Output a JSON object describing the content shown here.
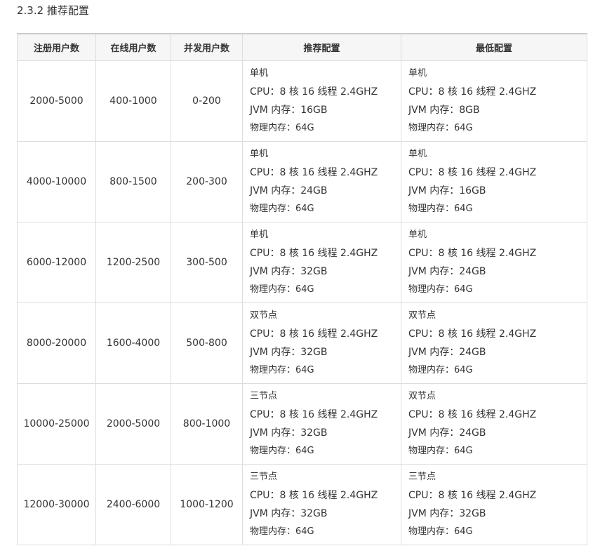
{
  "section_title": "2.3.2 推荐配置",
  "table": {
    "headers": [
      "注册用户数",
      "在线用户数",
      "并发用户数",
      "推荐配置",
      "最低配置"
    ],
    "rows": [
      {
        "registered": "2000-5000",
        "online": "400-1000",
        "concurrent": "0-200",
        "recommended": [
          "单机",
          "CPU：8 核 16 线程 2.4GHZ",
          "JVM 内存：16GB",
          "物理内存：64G"
        ],
        "minimum": [
          "单机",
          "CPU：8 核 16 线程 2.4GHZ",
          "JVM 内存：8GB",
          "物理内存：64G"
        ]
      },
      {
        "registered": "4000-10000",
        "online": "800-1500",
        "concurrent": "200-300",
        "recommended": [
          "单机",
          "CPU：8 核 16 线程 2.4GHZ",
          "JVM 内存：24GB",
          "物理内存：64G"
        ],
        "minimum": [
          "单机",
          "CPU：8 核 16 线程 2.4GHZ",
          "JVM 内存：16GB",
          "物理内存：64G"
        ]
      },
      {
        "registered": "6000-12000",
        "online": "1200-2500",
        "concurrent": "300-500",
        "recommended": [
          "单机",
          "CPU：8 核 16 线程 2.4GHZ",
          "JVM 内存：32GB",
          "物理内存：64G"
        ],
        "minimum": [
          "单机",
          "CPU：8 核 16 线程 2.4GHZ",
          "JVM 内存：24GB",
          "物理内存：64G"
        ]
      },
      {
        "registered": "8000-20000",
        "online": "1600-4000",
        "concurrent": "500-800",
        "recommended": [
          "双节点",
          "CPU：8 核 16 线程 2.4GHZ",
          "JVM 内存：32GB",
          "物理内存：64G"
        ],
        "minimum": [
          "双节点",
          "CPU：8 核 16 线程 2.4GHZ",
          "JVM 内存：24GB",
          "物理内存：64G"
        ]
      },
      {
        "registered": "10000-25000",
        "online": "2000-5000",
        "concurrent": "800-1000",
        "recommended": [
          "三节点",
          "CPU：8 核 16 线程 2.4GHZ",
          "JVM 内存：32GB",
          "物理内存：64G"
        ],
        "minimum": [
          "双节点",
          "CPU：8 核 16 线程 2.4GHZ",
          "JVM 内存：24GB",
          "物理内存：64G"
        ]
      },
      {
        "registered": "12000-30000",
        "online": "2400-6000",
        "concurrent": "1000-1200",
        "recommended": [
          "三节点",
          "CPU：8 核 16 线程 2.4GHZ",
          "JVM 内存：32GB",
          "物理内存：64G"
        ],
        "minimum": [
          "三节点",
          "CPU：8 核 16 线程 2.4GHZ",
          "JVM 内存：32GB",
          "物理内存：64G"
        ]
      }
    ]
  }
}
